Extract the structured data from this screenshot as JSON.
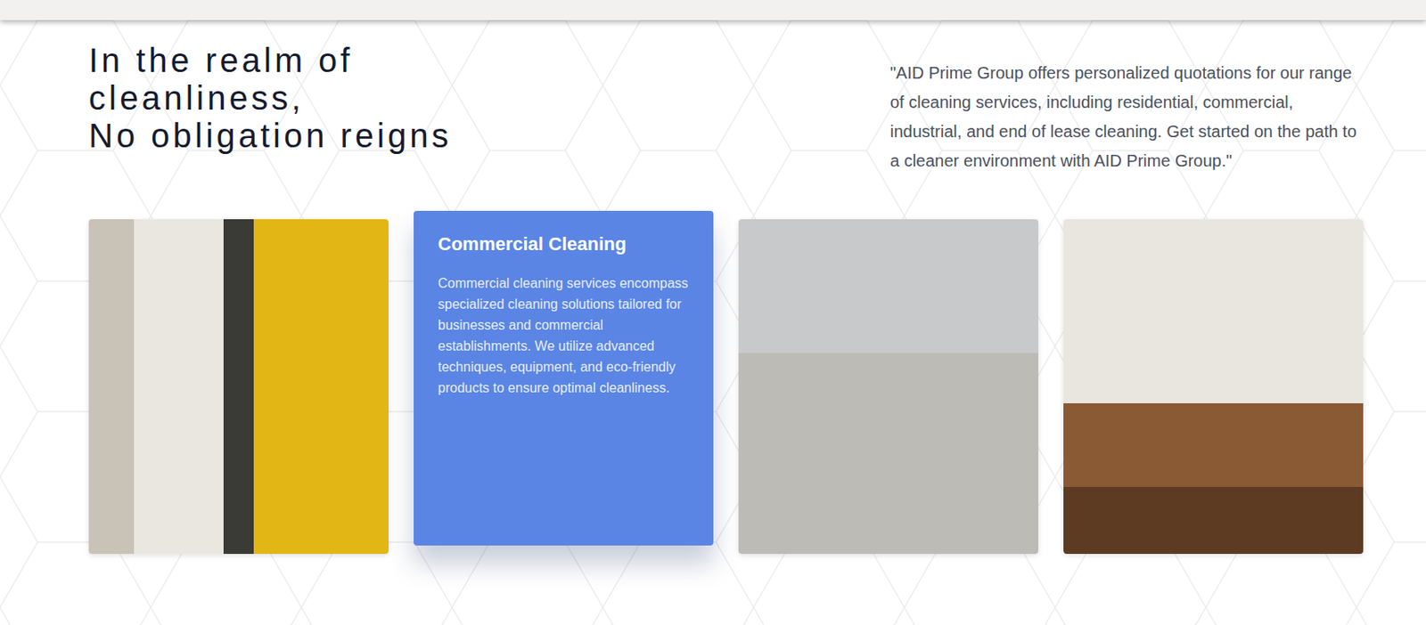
{
  "heading": {
    "lines": [
      "In the realm of cleanliness,",
      "No obligation reigns"
    ]
  },
  "quote": "\"AID Prime Group offers personalized quotations for our range of cleaning services, including residential, commercial, industrial, and end of lease cleaning. Get started on the path to a cleaner environment with AID Prime Group.\"",
  "cards": [
    {
      "selected": false
    },
    {
      "selected": true,
      "title": "Commercial Cleaning",
      "text": "Commercial cleaning services encompass specialized cleaning solutions tailored for businesses and commercial establishments. We utilize advanced techniques, equipment, and eco-friendly products to ensure optimal cleanliness."
    },
    {
      "selected": false
    },
    {
      "selected": false
    }
  ]
}
